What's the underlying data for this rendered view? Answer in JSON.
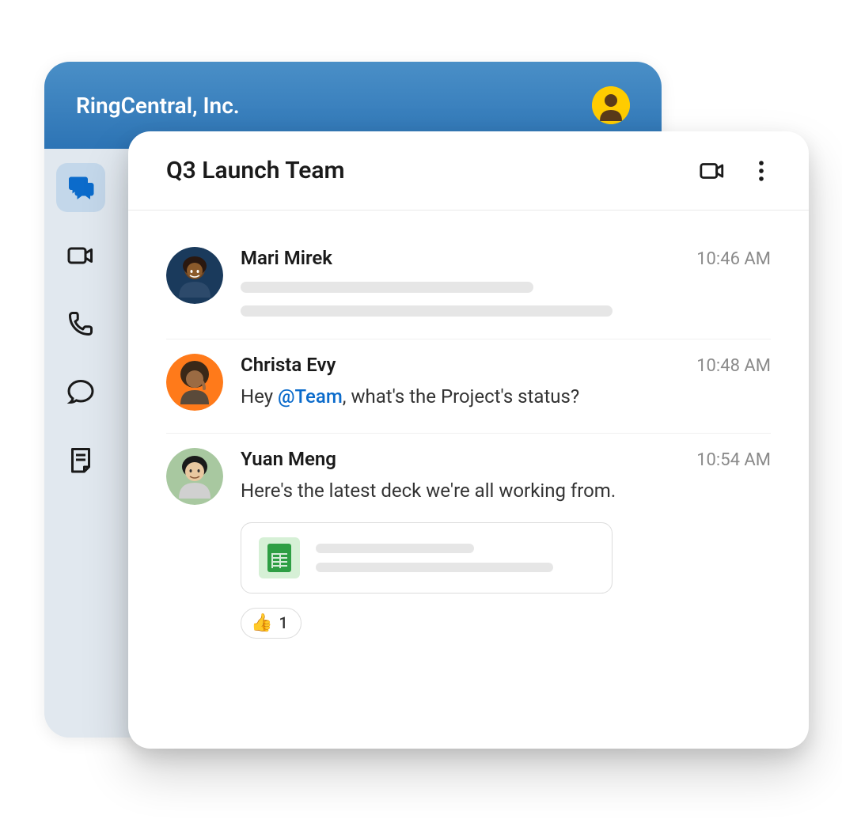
{
  "header": {
    "org_name": "RingCentral, Inc."
  },
  "sidebar": {
    "items": [
      {
        "name": "messages",
        "active": true
      },
      {
        "name": "video",
        "active": false
      },
      {
        "name": "phone",
        "active": false
      },
      {
        "name": "chat",
        "active": false
      },
      {
        "name": "notes",
        "active": false
      }
    ]
  },
  "channel": {
    "title": "Q3 Launch Team"
  },
  "messages": [
    {
      "author": "Mari Mirek",
      "time": "10:46 AM",
      "body": "",
      "placeholder": true
    },
    {
      "author": "Christa Evy",
      "time": "10:48 AM",
      "body_prefix": "Hey ",
      "mention": "@Team",
      "body_suffix": ", what's the Project's status?"
    },
    {
      "author": "Yuan Meng",
      "time": "10:54 AM",
      "body": "Here's the latest deck we're all working from.",
      "attachment": {
        "type": "sheets"
      },
      "reaction": {
        "emoji": "👍",
        "count": "1"
      }
    }
  ]
}
